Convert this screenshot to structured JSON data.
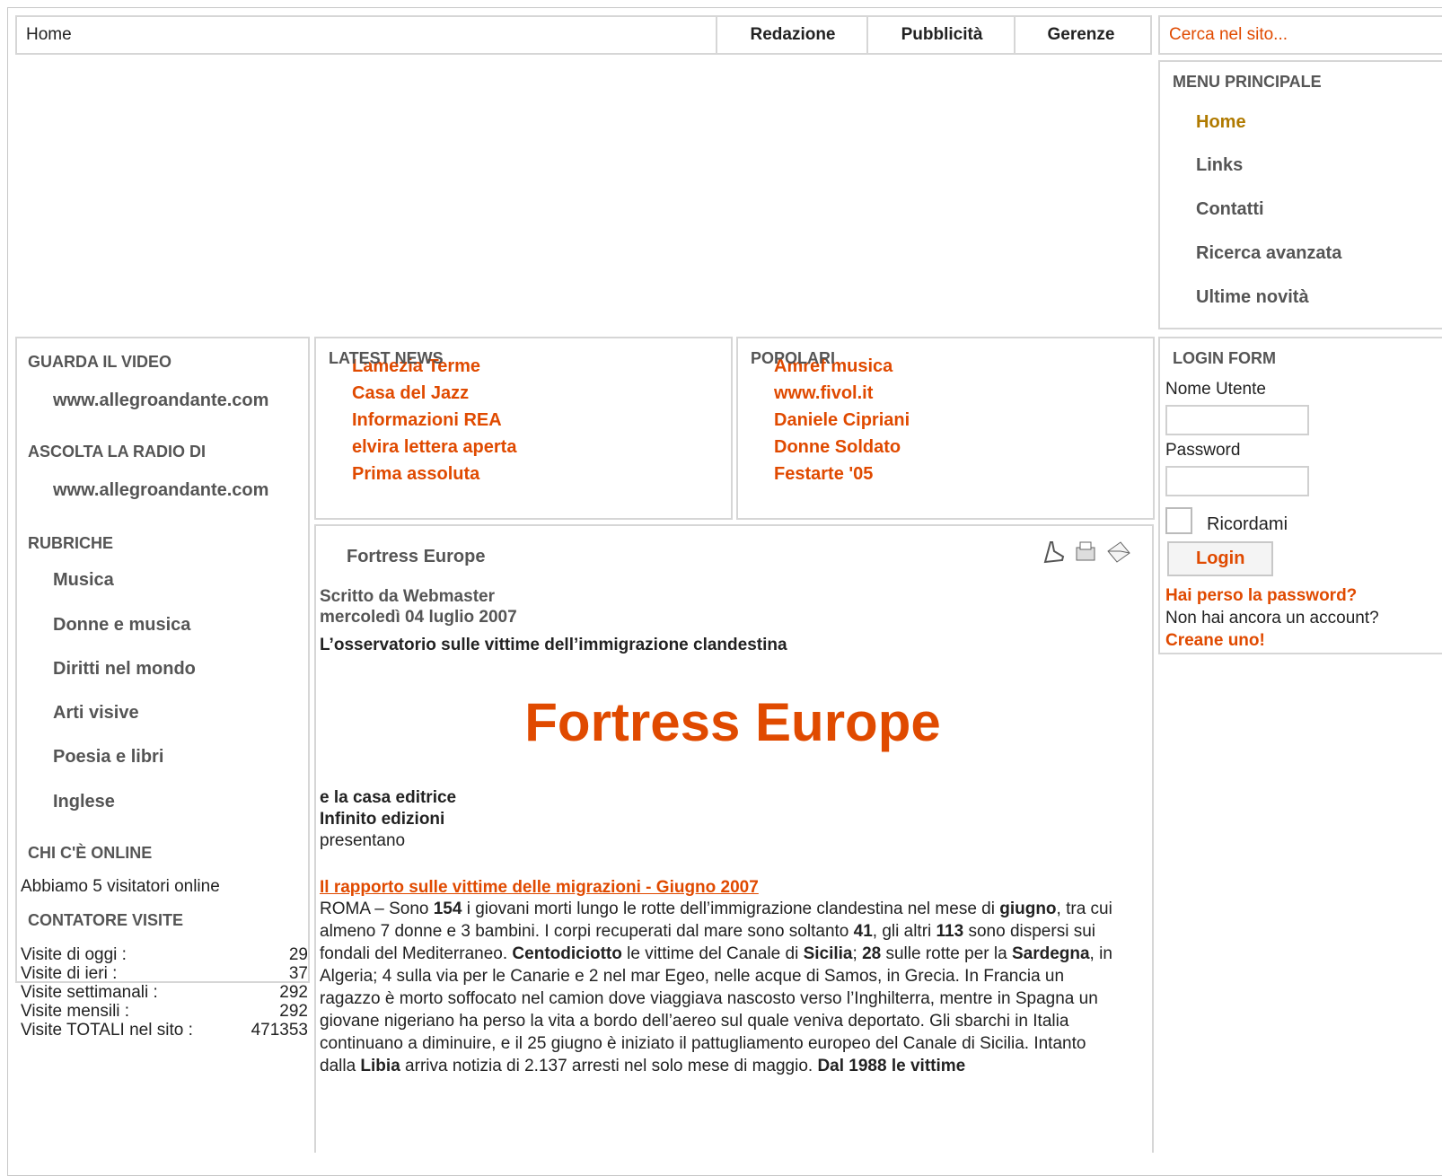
{
  "top_nav": {
    "home": "Home",
    "links": [
      "Redazione",
      "Pubblicità",
      "Gerenze"
    ],
    "search_placeholder": "Cerca nel sito..."
  },
  "main_menu": {
    "title": "MENU PRINCIPALE",
    "items": [
      "Home",
      "Links",
      "Contatti",
      "Ricerca avanzata",
      "Ultime novità"
    ],
    "active_color": "#b07a00"
  },
  "left_col": {
    "video_title": "GUARDA IL VIDEO",
    "video_link": "www.allegroandante.com",
    "radio_title": "ASCOLTA LA RADIO DI",
    "radio_link": "www.allegroandante.com",
    "rubriche_title": "RUBRICHE",
    "rubriche": [
      "Musica",
      "Donne e musica",
      "Diritti nel mondo",
      "Arti visive",
      "Poesia e libri",
      "Inglese"
    ],
    "online_title": "CHI C'È ONLINE",
    "online_text": "Abbiamo 5 visitatori online",
    "counter_title": "CONTATORE VISITE",
    "counter": [
      {
        "label": "Visite di oggi :",
        "value": "29"
      },
      {
        "label": "Visite di ieri :",
        "value": "37"
      },
      {
        "label": "Visite settimanali :",
        "value": "292"
      },
      {
        "label": "Visite mensili :",
        "value": "292"
      },
      {
        "label": "Visite TOTALI nel sito :",
        "value": "471353"
      }
    ]
  },
  "latest_news": {
    "title": "LATEST NEWS",
    "items": [
      "Lamezia Terme",
      "Casa del Jazz",
      "Informazioni REA",
      "elvira lettera aperta",
      "Prima assoluta"
    ]
  },
  "popolari": {
    "title": "POPOLARI",
    "items": [
      "Amref musica",
      "www.fivol.it",
      "Daniele Cipriani",
      "Donne Soldato",
      "Festarte '05"
    ]
  },
  "login": {
    "title": "LOGIN FORM",
    "username_label": "Nome Utente",
    "password_label": "Password",
    "remember_label": "Ricordami",
    "button": "Login",
    "lost_password": "Hai perso la password?",
    "no_account": "Non hai ancora un account?",
    "create": "Creane uno!"
  },
  "article": {
    "heading": "Fortress Europe",
    "author": "Scritto da Webmaster",
    "date": "mercoledì 04 luglio 2007",
    "subtitle": "L’osservatorio sulle vittime dell’immigrazione clandestina",
    "big_title": "Fortress Europe",
    "publisher_1": "e la casa editrice",
    "publisher_2": "Infinito edizioni",
    "publisher_3": "presentano",
    "report_link": "Il rapporto sulle vittime delle migrazioni - Giugno 2007",
    "icons": [
      "pdf-icon",
      "print-icon",
      "email-icon"
    ]
  }
}
